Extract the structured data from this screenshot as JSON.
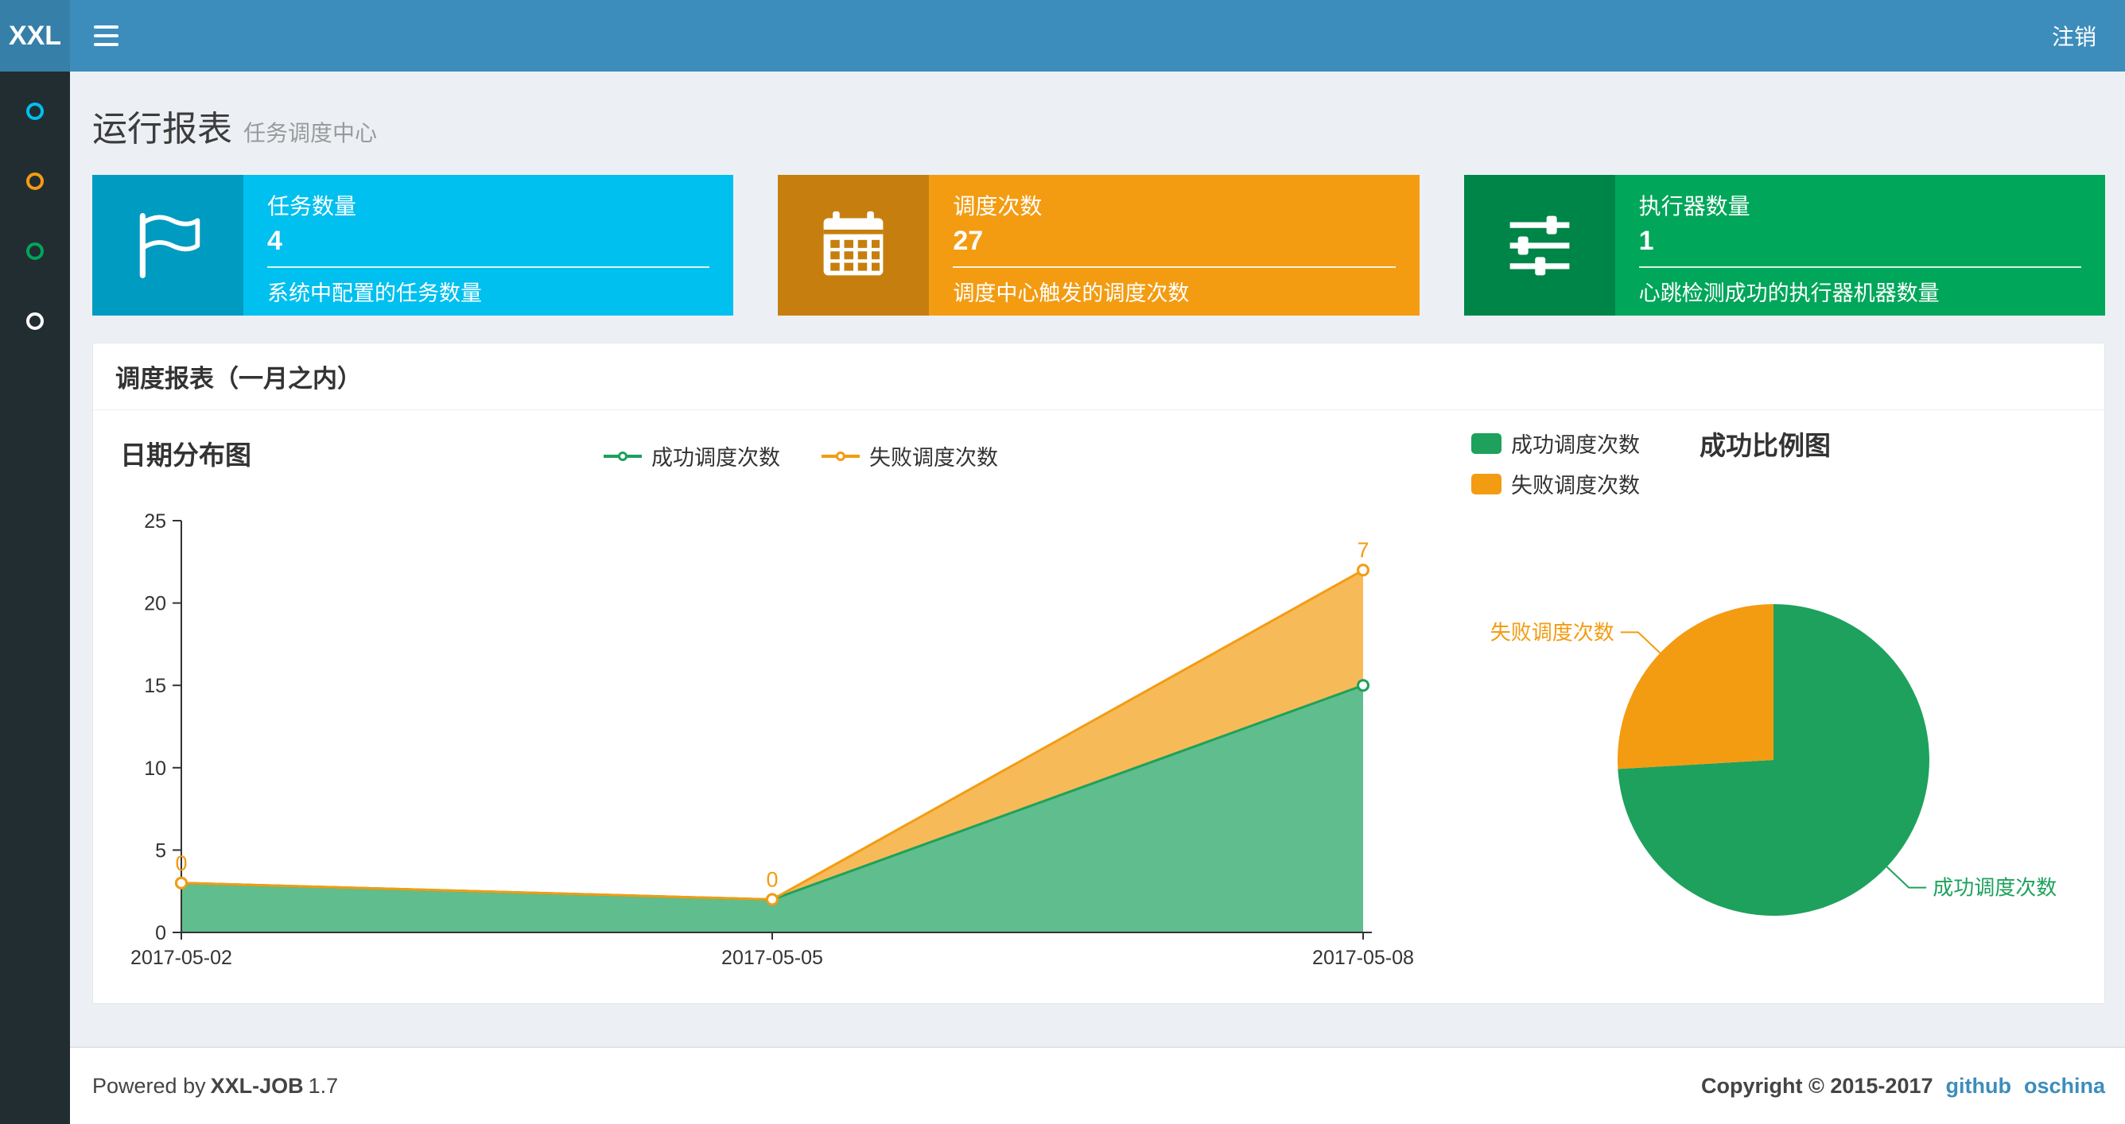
{
  "navbar": {
    "logo": "XXL",
    "logout_label": "注销"
  },
  "sidebar": {
    "items": [
      {
        "icon": "circle-icon",
        "color": "#00c0ef"
      },
      {
        "icon": "circle-icon",
        "color": "#f39c12"
      },
      {
        "icon": "circle-icon",
        "color": "#00a65a"
      },
      {
        "icon": "circle-icon",
        "color": "#ffffff"
      }
    ]
  },
  "page_header": {
    "title": "运行报表",
    "subtitle": "任务调度中心"
  },
  "info_boxes": [
    {
      "title": "任务数量",
      "value": "4",
      "desc": "系统中配置的任务数量",
      "color": "#00c0ef",
      "icon": "flag-icon"
    },
    {
      "title": "调度次数",
      "value": "27",
      "desc": "调度中心触发的调度次数",
      "color": "#f39c12",
      "icon": "calendar-icon"
    },
    {
      "title": "执行器数量",
      "value": "1",
      "desc": "心跳检测成功的执行器机器数量",
      "color": "#00a65a",
      "icon": "sliders-icon"
    }
  ],
  "panel": {
    "title": "调度报表（一月之内）"
  },
  "chart_data": [
    {
      "type": "area",
      "title": "日期分布图",
      "x": [
        "2017-05-02",
        "2017-05-05",
        "2017-05-08"
      ],
      "series": [
        {
          "name": "成功调度次数",
          "color": "#1da15c",
          "fill": "rgba(29,161,92,0.7)",
          "values": [
            3,
            2,
            15
          ]
        },
        {
          "name": "失败调度次数",
          "color": "#f39c12",
          "fill": "rgba(243,156,18,0.7)",
          "values": [
            0,
            0,
            7
          ],
          "point_labels": [
            "0",
            "0",
            "7"
          ]
        }
      ],
      "stacked": true,
      "ylim": [
        0,
        25
      ],
      "yticks": [
        0,
        5,
        10,
        15,
        20,
        25
      ],
      "grid": false,
      "legend_position": "top-center"
    },
    {
      "type": "pie",
      "title": "成功比例图",
      "slices": [
        {
          "name": "成功调度次数",
          "value": 20,
          "color": "#1da15c"
        },
        {
          "name": "失败调度次数",
          "value": 7,
          "color": "#f39c12"
        }
      ],
      "start_angle": "top",
      "direction": "clockwise",
      "legend_position": "top-left"
    }
  ],
  "footer": {
    "powered_prefix": "Powered by",
    "brand": "XXL-JOB",
    "version": "1.7",
    "copyright": "Copyright © 2015-2017",
    "links": [
      "github",
      "oschina"
    ]
  }
}
